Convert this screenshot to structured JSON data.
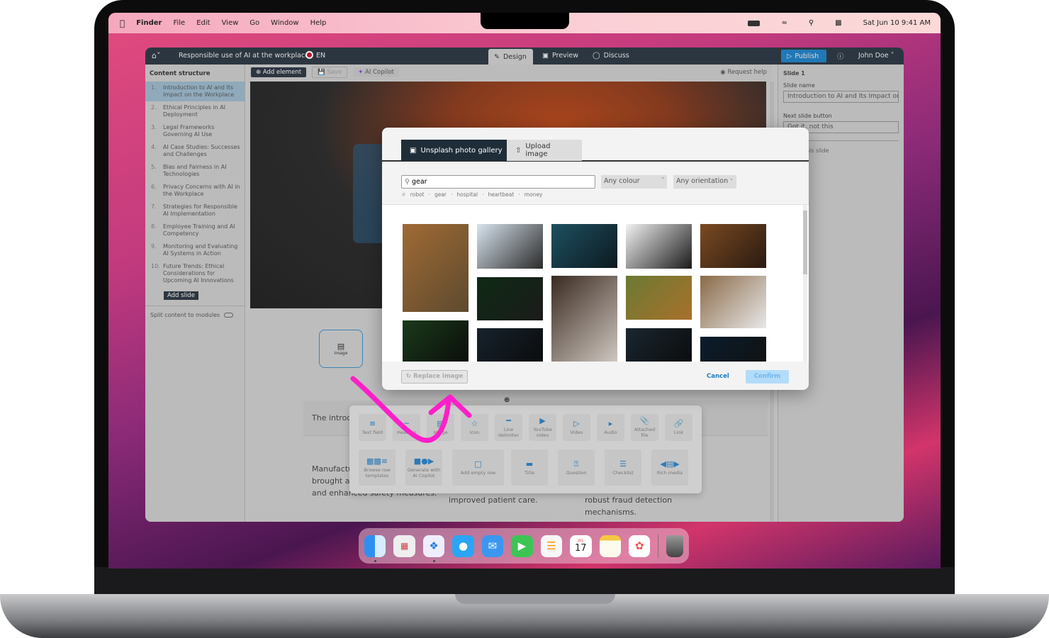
{
  "menubar": {
    "finder": "Finder",
    "items": [
      "File",
      "Edit",
      "View",
      "Go",
      "Window",
      "Help"
    ],
    "clock": "Sat Jun 10  9:41 AM"
  },
  "app": {
    "course_title": "Responsible use of AI at the workplace",
    "language": "EN",
    "tabs": [
      "Design",
      "Preview",
      "Discuss"
    ],
    "active_tab": "Design",
    "publish": "Publish",
    "user": "John Doe",
    "toolbar": {
      "add_element": "Add element",
      "save": "Save",
      "ai_copilot": "AI Copilot",
      "request_help": "Request help"
    },
    "sidebar": {
      "title": "Content structure",
      "slides": [
        {
          "n": "1.",
          "label": "Introduction to AI and Its Impact on the Workplace"
        },
        {
          "n": "2.",
          "label": "Ethical Principles in AI Deployment"
        },
        {
          "n": "3.",
          "label": "Legal Frameworks Governing AI Use"
        },
        {
          "n": "4.",
          "label": "AI Case Studies: Successes and Challenges"
        },
        {
          "n": "5.",
          "label": "Bias and Fairness in AI Technologies"
        },
        {
          "n": "6.",
          "label": "Privacy Concerns with AI in the Workplace"
        },
        {
          "n": "7.",
          "label": "Strategies for Responsible AI Implementation"
        },
        {
          "n": "8.",
          "label": "Employee Training and AI Competency"
        },
        {
          "n": "9.",
          "label": "Monitoring and Evaluating AI Systems in Action"
        },
        {
          "n": "10.",
          "label": "Future Trends: Ethical Considerations for Upcoming AI Innovations"
        }
      ],
      "add_slide": "Add slide",
      "split": "Split content to modules"
    },
    "right_panel": {
      "title": "Slide 1",
      "slide_name_label": "Slide name",
      "slide_name": "Introduction to AI and Its Impact on the Workplace",
      "next_label": "Next slide button",
      "next_value": "Got it, not this",
      "delete": "Delete this slide"
    },
    "canvas": {
      "image_label": "Image",
      "intro": "The introduction of AI",
      "col1": [
        "Manufacturing: AI has",
        "brought about efficiency",
        "and enhanced safety measures."
      ],
      "col2": "improved patient care.",
      "col3": [
        "robust fraud detection",
        "mechanisms."
      ]
    }
  },
  "modal": {
    "tabs": [
      "Unsplash photo gallery",
      "Upload image"
    ],
    "active_tab": "Unsplash photo gallery",
    "search": "gear",
    "colour": "Any colour",
    "orientation": "Any orientation",
    "suggestions": [
      "robot",
      "gear",
      "hospital",
      "heartbeat",
      "money"
    ],
    "replace": "Replace image",
    "cancel": "Cancel",
    "confirm": "Confirm"
  },
  "palette": {
    "row1": [
      "Text field",
      "Heading",
      "Image",
      "Icon",
      "Line delimiter",
      "YouTube video",
      "Video",
      "Audio",
      "Attached file",
      "Link"
    ],
    "row2": [
      "Browse row templates",
      "Generate with AI Copilot",
      "Add empty row",
      "Title",
      "Question",
      "Checklist",
      "Rich media"
    ]
  },
  "dock": {
    "calendar_month": "JUL",
    "calendar_day": "17"
  },
  "colors": {
    "accent": "#1f7dc1",
    "header": "#2b3640",
    "annotation": "#ff1fc8"
  }
}
